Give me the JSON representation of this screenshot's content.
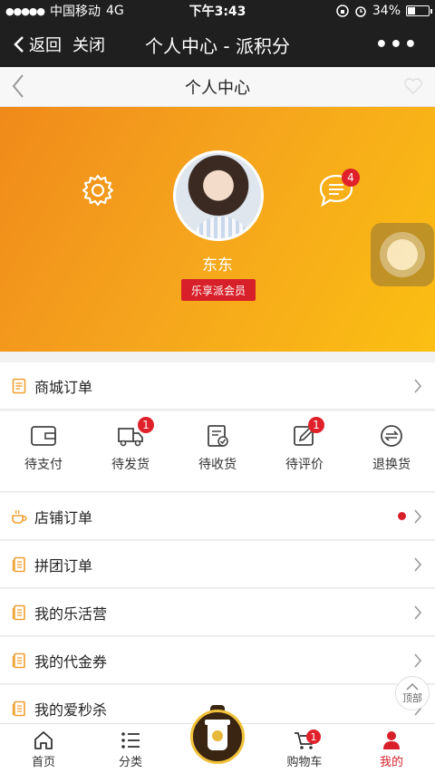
{
  "status": {
    "carrier": "中国移动",
    "network": "4G",
    "time": "下午3:43",
    "battery": "34%"
  },
  "nav": {
    "back": "返回",
    "close": "关闭",
    "title": "个人中心 - 派积分"
  },
  "subheader": {
    "title": "个人中心"
  },
  "profile": {
    "name": "东东",
    "member": "乐享派会员",
    "message_count": "4"
  },
  "mall_order": {
    "label": "商城订单"
  },
  "order_status": [
    {
      "label": "待支付",
      "badge": ""
    },
    {
      "label": "待发货",
      "badge": "1"
    },
    {
      "label": "待收货",
      "badge": ""
    },
    {
      "label": "待评价",
      "badge": "1"
    },
    {
      "label": "退换货",
      "badge": ""
    }
  ],
  "rows": [
    {
      "label": "店铺订单"
    },
    {
      "label": "拼团订单"
    },
    {
      "label": "我的乐活营"
    },
    {
      "label": "我的代金券"
    },
    {
      "label": "我的爱秒杀"
    }
  ],
  "top_button": "顶部",
  "tabbar": {
    "home": "首页",
    "category": "分类",
    "cart": "购物车",
    "cart_badge": "1",
    "mine": "我的"
  },
  "colors": {
    "accent": "#d8202a",
    "hero_start": "#f08a1a",
    "hero_end": "#fbbf12"
  }
}
